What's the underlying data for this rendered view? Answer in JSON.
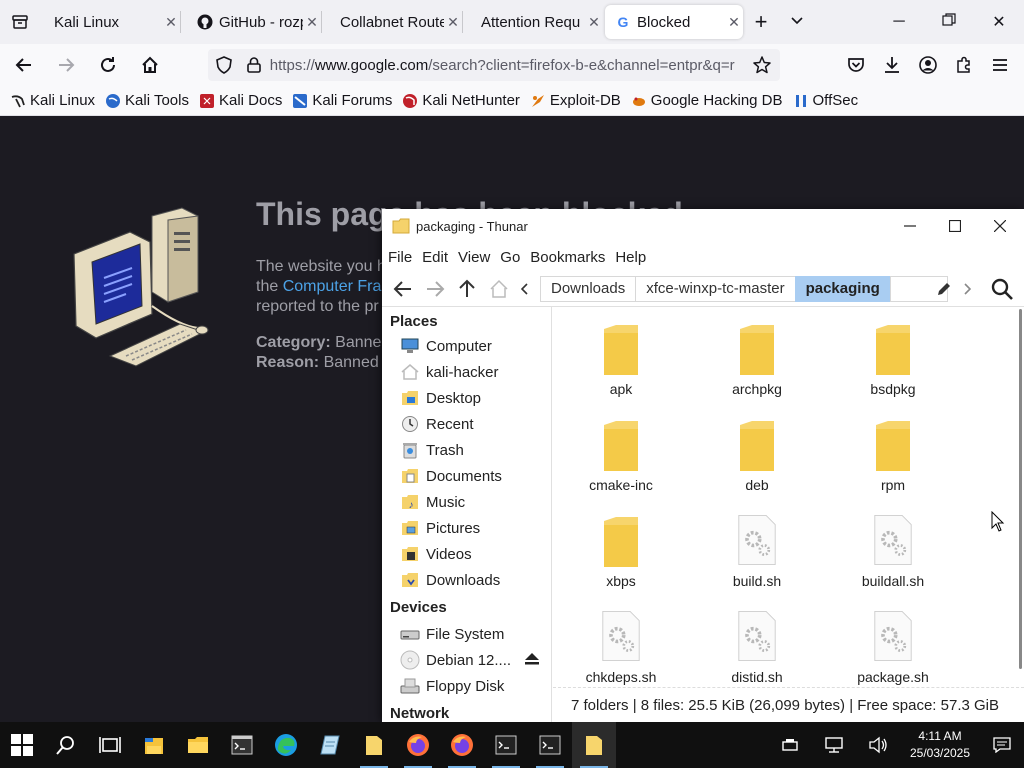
{
  "browser": {
    "tabs": [
      {
        "label": "Kali Linux",
        "favicon": "kali-dragon-icon"
      },
      {
        "label": "GitHub - rozp",
        "favicon": "github-icon"
      },
      {
        "label": "Collabnet Route",
        "favicon": "none"
      },
      {
        "label": "Attention Requ",
        "favicon": "none"
      },
      {
        "label": "Blocked",
        "favicon": "google-icon",
        "active": true
      }
    ],
    "url_prefix": "https://",
    "url_host": "www.google.com",
    "url_path": "/search?client=firefox-b-e&channel=entpr&q=r",
    "bookmarks": [
      {
        "label": "Kali Linux",
        "color": "#222222"
      },
      {
        "label": "Kali Tools",
        "color": "#2a6acb"
      },
      {
        "label": "Kali Docs",
        "color": "#c0202a"
      },
      {
        "label": "Kali Forums",
        "color": "#2a6acb"
      },
      {
        "label": "Kali NetHunter",
        "color": "#c0202a"
      },
      {
        "label": "Exploit-DB",
        "color": "#e07a10"
      },
      {
        "label": "Google Hacking DB",
        "color": "#e07a10"
      },
      {
        "label": "OffSec",
        "color": "#2a6acb"
      }
    ]
  },
  "blocked_page": {
    "title": "This page has been blocked",
    "line1": "The website you h",
    "line2_prefix": "the ",
    "line2_link": "Computer Fra",
    "line3": "reported to the pr",
    "category_label": "Category:",
    "category_value": "Banned",
    "reason_label": "Reason:",
    "reason_value": "Banned p"
  },
  "thunar": {
    "title": "packaging - Thunar",
    "menu": [
      "File",
      "Edit",
      "View",
      "Go",
      "Bookmarks",
      "Help"
    ],
    "breadcrumbs": [
      "Downloads",
      "xfce-winxp-tc-master",
      "packaging"
    ],
    "places_heading": "Places",
    "places": [
      {
        "label": "Computer",
        "icon": "computer-icon"
      },
      {
        "label": "kali-hacker",
        "icon": "home-icon"
      },
      {
        "label": "Desktop",
        "icon": "desktop-folder-icon"
      },
      {
        "label": "Recent",
        "icon": "recent-icon"
      },
      {
        "label": "Trash",
        "icon": "trash-icon"
      },
      {
        "label": "Documents",
        "icon": "documents-folder-icon"
      },
      {
        "label": "Music",
        "icon": "music-folder-icon"
      },
      {
        "label": "Pictures",
        "icon": "pictures-folder-icon"
      },
      {
        "label": "Videos",
        "icon": "videos-folder-icon"
      },
      {
        "label": "Downloads",
        "icon": "downloads-folder-icon"
      }
    ],
    "devices_heading": "Devices",
    "devices": [
      {
        "label": "File System",
        "icon": "drive-icon"
      },
      {
        "label": "Debian 12....",
        "icon": "disc-icon",
        "eject": true
      },
      {
        "label": "Floppy Disk",
        "icon": "floppy-icon"
      }
    ],
    "network_heading": "Network",
    "files": [
      {
        "name": "apk",
        "type": "folder"
      },
      {
        "name": "archpkg",
        "type": "folder"
      },
      {
        "name": "bsdpkg",
        "type": "folder"
      },
      {
        "name": "cmake-inc",
        "type": "folder"
      },
      {
        "name": "deb",
        "type": "folder"
      },
      {
        "name": "rpm",
        "type": "folder"
      },
      {
        "name": "xbps",
        "type": "folder"
      },
      {
        "name": "build.sh",
        "type": "script"
      },
      {
        "name": "buildall.sh",
        "type": "script"
      },
      {
        "name": "chkdeps.sh",
        "type": "script"
      },
      {
        "name": "distid.sh",
        "type": "script"
      },
      {
        "name": "package.sh",
        "type": "script"
      }
    ],
    "status": "7 folders  |  8 files: 25.5 KiB (26,099 bytes)  |  Free space: 57.3 GiB"
  },
  "taskbar": {
    "time": "4:11 AM",
    "date": "25/03/2025"
  },
  "colors": {
    "folder": "#f5d26b",
    "selection": "#a9cdf2",
    "taskbar": "#101010",
    "page_bg": "#1c1b22"
  }
}
